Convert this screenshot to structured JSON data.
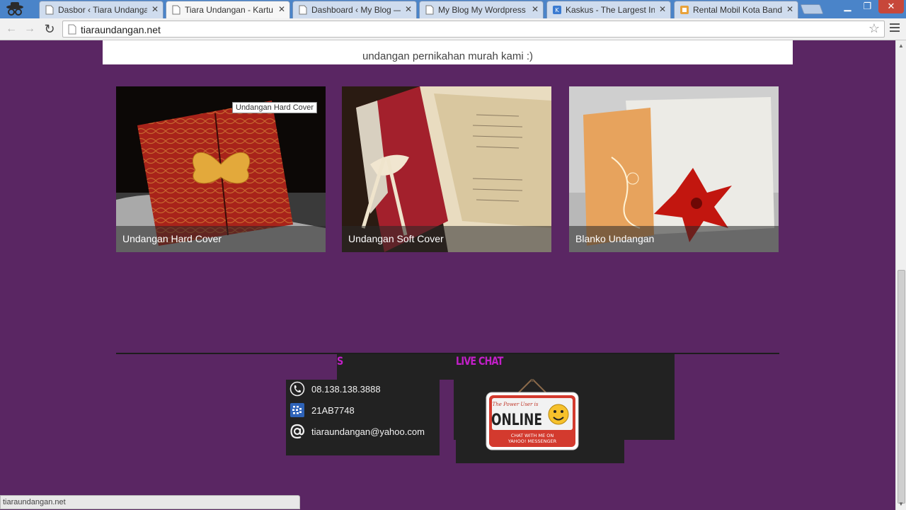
{
  "browser": {
    "tabs": [
      {
        "title": "Dasbor ‹ Tiara Undangan",
        "active": false
      },
      {
        "title": "Tiara Undangan - Kartu Ul",
        "active": true
      },
      {
        "title": "Dashboard ‹ My Blog — W",
        "active": false
      },
      {
        "title": "My Blog My Wordpress Bl",
        "active": false
      },
      {
        "title": "Kaskus - The Largest Indo",
        "active": false
      },
      {
        "title": "Rental Mobil Kota Bandun",
        "active": false
      }
    ],
    "url": "tiaraundangan.net",
    "status_url": "tiaraundangan.net"
  },
  "page": {
    "intro_text": "undangan pernikahan murah kami :)",
    "cards": [
      {
        "caption": "Undangan Hard Cover"
      },
      {
        "caption": "Undangan Soft Cover"
      },
      {
        "caption": "Blanko Undangan"
      }
    ],
    "tooltip": "Undangan Hard Cover",
    "footer": {
      "contact_heading": "S",
      "contacts": [
        {
          "icon": "phone-icon",
          "text": "08.138.138.3888"
        },
        {
          "icon": "blackberry-icon",
          "text": "21AB7748"
        },
        {
          "icon": "at-sign-icon",
          "text": "tiaraundangan@yahoo.com"
        }
      ],
      "livechat_heading": "LIVE CHAT",
      "online_sign": {
        "top_text": "The Power User is",
        "main_text": "ONLINE",
        "bottom_line1": "CHAT WITH ME ON",
        "bottom_line2": "YAHOO! MESSENGER"
      }
    }
  },
  "colors": {
    "page_bg": "#5a2663",
    "heading_accent": "#c21fc8",
    "footer_box": "#222222"
  }
}
